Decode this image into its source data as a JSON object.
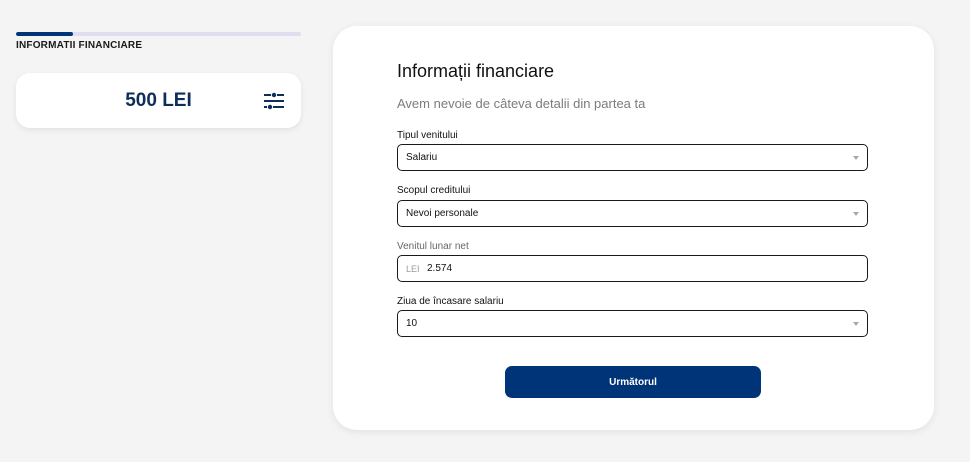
{
  "progress": {
    "fraction": 0.2,
    "step_label": "INFORMATII FINANCIARE"
  },
  "summary": {
    "amount": "500 LEI",
    "icon": "filter-sliders-icon"
  },
  "form": {
    "title": "Informații financiare",
    "subtitle": "Avem nevoie de câteva detalii din partea ta",
    "fields": [
      {
        "label": "Tipul venitului",
        "value": "Salariu"
      },
      {
        "label": "Scopul creditului",
        "value": "Nevoi personale"
      },
      {
        "label": "Venitul lunar net",
        "prefix": "LEI",
        "value": "2.574"
      },
      {
        "label": "Ziua de încasare salariu",
        "value": "10"
      }
    ],
    "next_label": "Următorul"
  },
  "colors": {
    "brand": "#003479",
    "amount_text": "#0f2d5a",
    "page_bg": "#f4f4f4"
  }
}
